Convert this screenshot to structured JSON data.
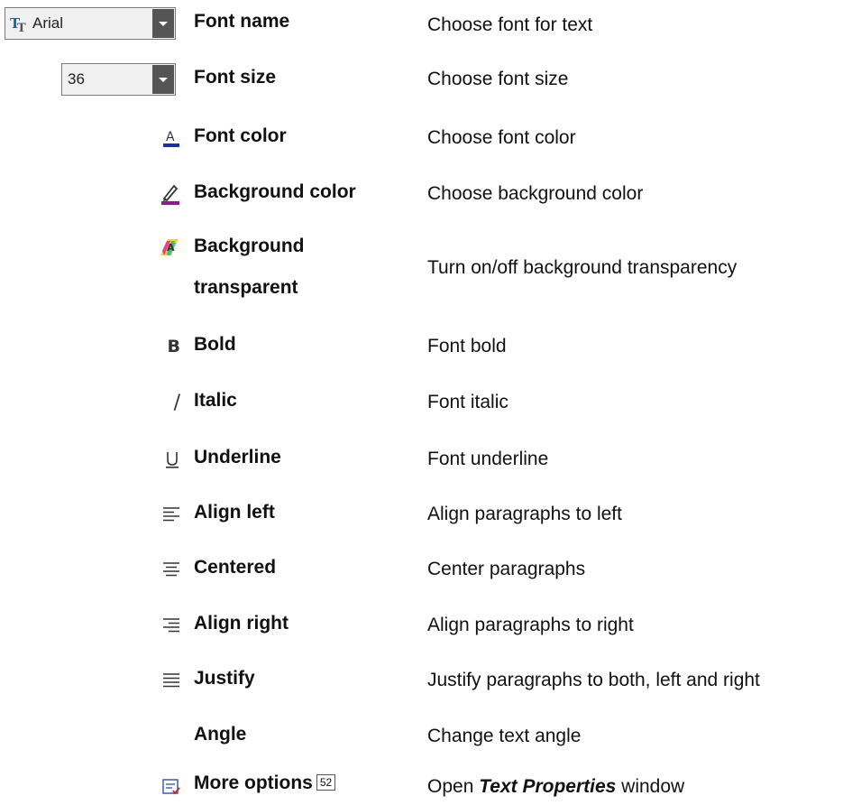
{
  "combos": {
    "font_name_value": "Arial",
    "font_size_value": "36"
  },
  "rows": [
    {
      "icon": "font-name-combo",
      "name": "Font name",
      "desc": "Choose font for text"
    },
    {
      "icon": "font-size-combo",
      "name": "Font size",
      "desc": "Choose font size"
    },
    {
      "icon": "font-color-icon",
      "name": "Font color",
      "desc": "Choose font color"
    },
    {
      "icon": "highlighter-icon",
      "name": "Background color",
      "desc": "Choose background color"
    },
    {
      "icon": "transparent-background-icon",
      "name_line1": "Background",
      "name_line2": "transparent",
      "desc": "Turn on/off background transparency"
    },
    {
      "icon": "bold-icon",
      "name": "Bold",
      "desc": "Font bold"
    },
    {
      "icon": "italic-icon",
      "name": "Italic",
      "desc": "Font italic"
    },
    {
      "icon": "underline-icon",
      "name": "Underline",
      "desc": "Font underline"
    },
    {
      "icon": "align-left-icon",
      "name": "Align left",
      "desc": "Align paragraphs to left"
    },
    {
      "icon": "align-center-icon",
      "name": "Centered",
      "desc": "Center paragraphs"
    },
    {
      "icon": "align-right-icon",
      "name": "Align right",
      "desc": "Align paragraphs to right"
    },
    {
      "icon": "justify-icon",
      "name": "Justify",
      "desc": "Justify paragraphs to both, left and right"
    },
    {
      "icon": "",
      "name": "Angle",
      "desc": "Change text angle"
    },
    {
      "icon": "more-options-icon",
      "name": "More options",
      "page_ref": "52",
      "desc_prefix": "Open ",
      "desc_em": "Text Properties",
      "desc_suffix": " window"
    }
  ]
}
